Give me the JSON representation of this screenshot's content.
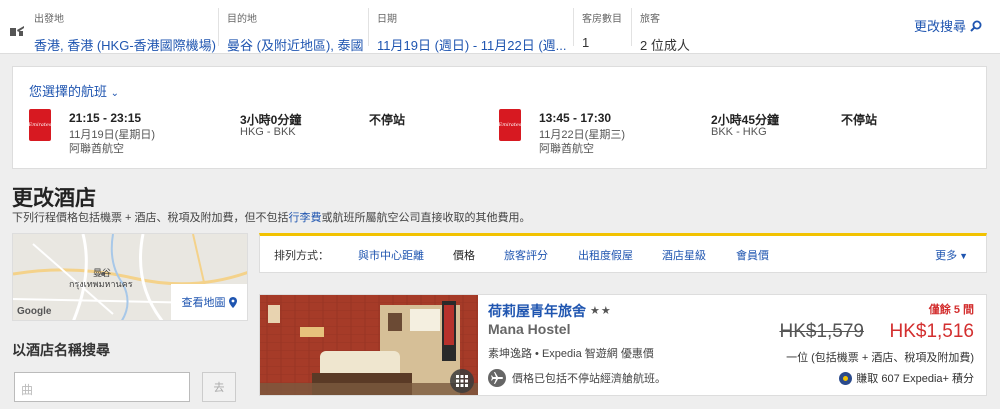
{
  "search": {
    "from_label": "出發地",
    "from_value": "香港, 香港 (HKG-香港國際機場)",
    "to_label": "目的地",
    "to_value": "曼谷 (及附近地區), 泰國",
    "date_label": "日期",
    "date_value": "11月19日 (週日) - 11月22日 (週...",
    "rooms_label": "客房數目",
    "rooms_value": "1",
    "travelers_label": "旅客",
    "travelers_value": "2 位成人",
    "modify_label": "更改搜尋"
  },
  "flights": {
    "title": "您選擇的航班",
    "airline_logo": "Emirates",
    "legs": [
      {
        "times": "21:15 - 23:15",
        "date": "11月19日(星期日)",
        "airline": "阿聯酋航空",
        "duration": "3小時0分鐘",
        "route": "HKG - BKK",
        "stops": "不停站"
      },
      {
        "times": "13:45 - 17:30",
        "date": "11月22日(星期三)",
        "airline": "阿聯酋航空",
        "duration": "2小時45分鐘",
        "route": "BKK - HKG",
        "stops": "不停站"
      }
    ]
  },
  "section": {
    "title": "更改酒店",
    "note_before": "下列行程價格包括機票 + 酒店、稅項及附加費，但不包括",
    "note_link": "行李費",
    "note_after": "或航班所屬航空公司直接收取的其他費用。"
  },
  "map": {
    "label_bkk_th": "กรุงเทพมหานคร",
    "label_bkk_zh": "曼谷",
    "google": "Google",
    "view_map": "查看地圖"
  },
  "name_search": {
    "title": "以酒店名稱搜尋",
    "placeholder": "曲",
    "go": "去"
  },
  "sort": {
    "label": "排列方式：",
    "options": [
      "與市中心距離",
      "價格",
      "旅客評分",
      "出租度假屋",
      "酒店星級",
      "會員價"
    ],
    "active_index": 1,
    "more": "更多"
  },
  "hotel": {
    "name": "荷莉屋青年旅舍",
    "stars": "★★",
    "name_en": "Mana Hostel",
    "area": "素坤逸路 • Expedia 智遊網 優惠價",
    "flight_note": "價格已包括不停站經濟艙航班。",
    "rooms_left": "僅餘 5 間",
    "old_price": "HK$1,579",
    "new_price": "HK$1,516",
    "price_note": "一位 (包括機票 + 酒店、稅項及附加費)",
    "points": "賺取 607 Expedia+ 積分"
  },
  "colors": {
    "link": "#1f55b0",
    "accent": "#f2c200",
    "price_red": "#d32f2f",
    "emirates_red": "#d71921"
  }
}
